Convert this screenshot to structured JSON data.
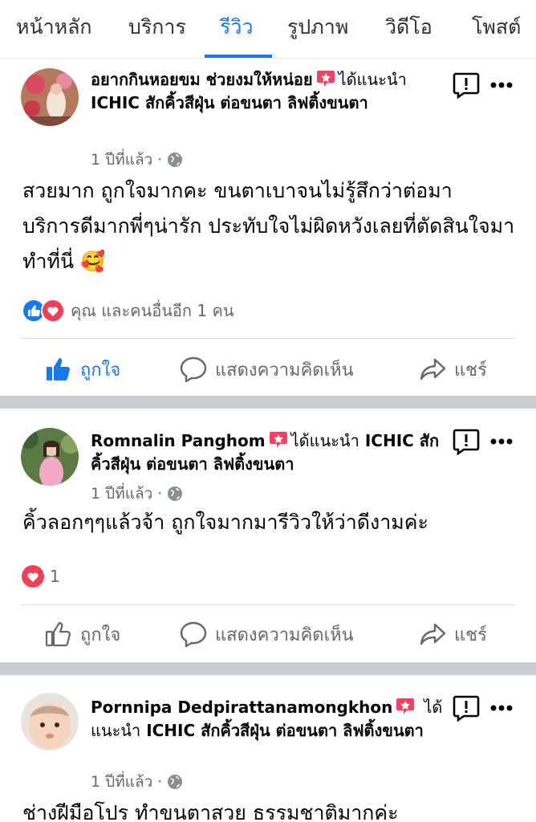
{
  "tabs": [
    {
      "label": "หน้าหลัก"
    },
    {
      "label": "บริการ"
    },
    {
      "label": "รีวิว"
    },
    {
      "label": "รูปภาพ"
    },
    {
      "label": "วิดีโอ"
    },
    {
      "label": "โพสต์"
    }
  ],
  "colors": {
    "accent": "#1877f2",
    "recommend": "#f3425f",
    "muted": "#65676b"
  },
  "posts": [
    {
      "author": "อยากกินหอยขม ช่วยงมให้หน่อย",
      "recommend_label": "ได้แนะนำ",
      "page_name": "ICHIC สักคิ้วสีฝุ่น ต่อขนตา ลิฟติ้งขนตา",
      "time": "1 ปีที่แล้ว ·",
      "text": "สวยมาก ถูกใจมากคะ ขนตาเบาจนไม่รู้สึกว่าต่อมา บริการดีมากพี่ๆน่ารัก ประทับใจไม่ผิดหวังเลยที่ตัดสินใจมาทำที่นี่ 🥰",
      "reactions_text": "คุณ และคนอื่นอีก 1 คน",
      "like_label": "ถูกใจ",
      "comment_label": "แสดงความคิดเห็น",
      "share_label": "แชร์"
    },
    {
      "author": "Romnalin Panghom",
      "recommend_label": "ได้แนะนำ",
      "page_name": "ICHIC สักคิ้วสีฝุ่น ต่อขนตา ลิฟติ้งขนตา",
      "time": "1 ปีที่แล้ว ·",
      "text": "คิ้วลอกๆๆแล้วจ้า ถูกใจมากมารีวิวให้ว่าดีงามค่ะ",
      "reactions_text": "1",
      "like_label": "ถูกใจ",
      "comment_label": "แสดงความคิดเห็น",
      "share_label": "แชร์"
    },
    {
      "author": "Pornnipa Dedpirattanamongkhon",
      "recommend_label": "ได้แนะนำ",
      "page_name": "ICHIC สักคิ้วสีฝุ่น ต่อขนตา ลิฟติ้งขนตา",
      "time": "1 ปีที่แล้ว ·",
      "text": "ช่างฝีมือโปร ทำขนตาสวย ธรรมชาติมากค่ะ"
    }
  ]
}
